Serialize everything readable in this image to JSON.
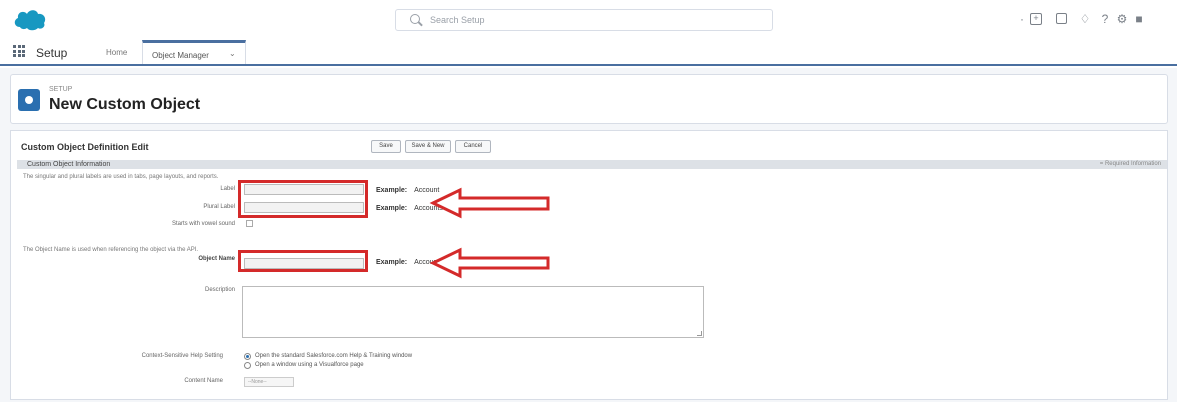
{
  "header": {
    "search_placeholder": "Search Setup",
    "icons": [
      "add-icon",
      "help-icon",
      "bell-icon",
      "question-icon",
      "gear-icon",
      "notification-icon"
    ]
  },
  "nav": {
    "app_name": "Setup",
    "home_label": "Home",
    "object_manager_label": "Object Manager"
  },
  "page": {
    "breadcrumb": "SETUP",
    "title": "New Custom Object"
  },
  "form": {
    "title": "Custom Object Definition Edit",
    "buttons": [
      "Save",
      "Save & New",
      "Cancel"
    ],
    "section_title": "Custom Object Information",
    "required_info": "= Required Information",
    "help_text_1": "The singular and plural labels are used in tabs, page layouts, and reports.",
    "label_label": "Label",
    "plural_label_label": "Plural Label",
    "example_label": "Example:",
    "example_label_value": "Account",
    "example_plural_value": "Accounts",
    "starts_with_vowel_label": "Starts with vowel sound",
    "help_text_2": "The Object Name is used when referencing the object via the API.",
    "object_name_label": "Object Name",
    "example_object_value": "Account",
    "description_label": "Description",
    "help_setting_label": "Context-Sensitive Help Setting",
    "radio_1": "Open the standard Salesforce.com Help & Training window",
    "radio_2": "Open a window using a Visualforce page",
    "content_name_label": "Content Name",
    "content_name_value": "--None--"
  },
  "colors": {
    "brand": "#1798c1",
    "accent": "#2a6fb0",
    "annotation_red": "#d42a2a"
  }
}
